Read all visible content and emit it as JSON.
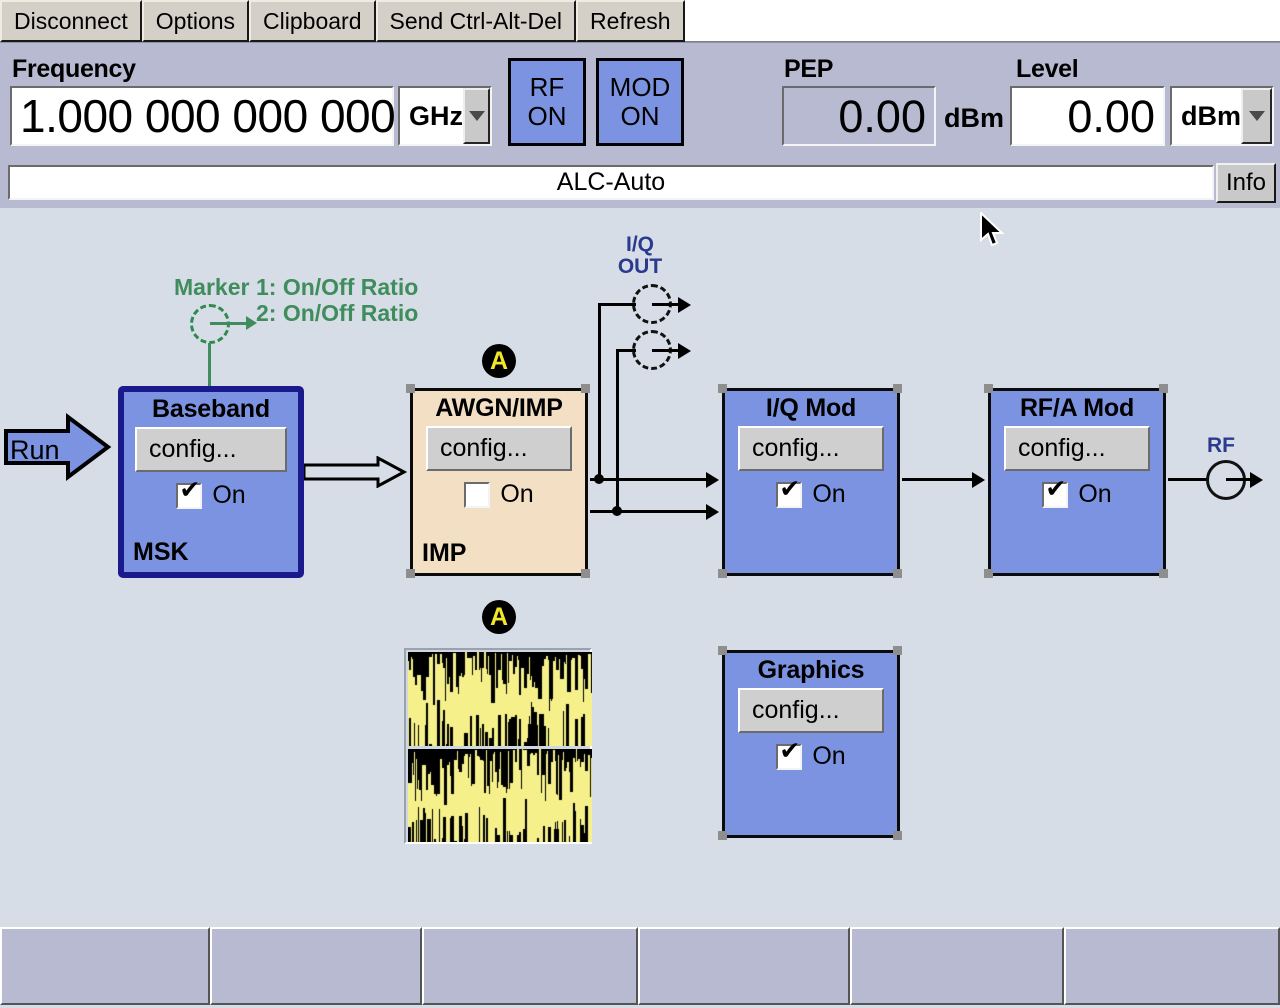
{
  "vnc_toolbar": {
    "buttons": [
      {
        "label": "Disconnect",
        "name": "disconnect-button"
      },
      {
        "label": "Options",
        "name": "options-button"
      },
      {
        "label": "Clipboard",
        "name": "clipboard-button"
      },
      {
        "label": "Send Ctrl-Alt-Del",
        "name": "send-ctrl-alt-del-button"
      },
      {
        "label": "Refresh",
        "name": "refresh-button"
      }
    ]
  },
  "header": {
    "frequency_label": "Frequency",
    "frequency_value": "1.000 000 000 000",
    "frequency_unit": "GHz",
    "rf_button": "RF\nON",
    "rf_button_line1": "RF",
    "rf_button_line2": "ON",
    "mod_button_line1": "MOD",
    "mod_button_line2": "ON",
    "pep_label": "PEP",
    "pep_value": "0.00",
    "pep_unit": "dBm",
    "level_label": "Level",
    "level_value": "0.00",
    "level_unit": "dBm"
  },
  "info_bar": {
    "status_text": "ALC-Auto",
    "info_button": "Info"
  },
  "diagram": {
    "run_label": "Run",
    "marker": {
      "title": "Marker",
      "line1": "1: On/Off Ratio",
      "line2": "2: On/Off Ratio",
      "color": "#3f8c5c"
    },
    "iq_out": {
      "line1": "I/Q",
      "line2": "OUT"
    },
    "rf_out_label": "RF",
    "badge_letter": "A",
    "blocks": [
      {
        "name": "baseband",
        "title": "Baseband",
        "config_label": "config...",
        "on_label": "On",
        "checked": true,
        "sub_label": "MSK",
        "selected": true,
        "color": "#7b93e0"
      },
      {
        "name": "awgn-imp",
        "title": "AWGN/IMP",
        "config_label": "config...",
        "on_label": "On",
        "checked": false,
        "sub_label": "IMP",
        "selected": false,
        "color": "#f2dfc4"
      },
      {
        "name": "iq-mod",
        "title": "I/Q Mod",
        "config_label": "config...",
        "on_label": "On",
        "checked": true,
        "sub_label": "",
        "selected": false,
        "color": "#7b93e0"
      },
      {
        "name": "rf-a-mod",
        "title": "RF/A Mod",
        "config_label": "config...",
        "on_label": "On",
        "checked": true,
        "sub_label": "",
        "selected": false,
        "color": "#7b93e0"
      },
      {
        "name": "graphics",
        "title": "Graphics",
        "config_label": "config...",
        "on_label": "On",
        "checked": true,
        "sub_label": "",
        "selected": false,
        "color": "#7b93e0"
      }
    ],
    "waveform": {
      "trace_color": "#f5f08a",
      "background_color": "#000000",
      "panels": 2
    }
  },
  "softkeys": {
    "labels": [
      "",
      "",
      "",
      "",
      "",
      ""
    ]
  }
}
